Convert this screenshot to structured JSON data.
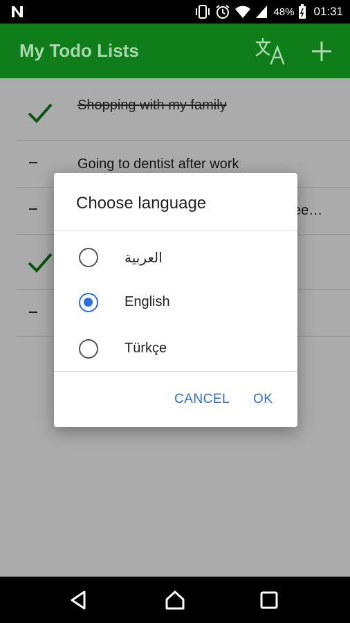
{
  "status_bar": {
    "battery_pct": "48%",
    "time": "01:31",
    "icons": [
      "n-notification-icon",
      "vibrate-icon",
      "alarm-icon",
      "wifi-icon",
      "signal-icon",
      "battery-icon"
    ]
  },
  "app_bar": {
    "title": "My Todo Lists",
    "translate_icon": "translate-icon",
    "add_icon": "add-icon",
    "color": "#0f7d1a"
  },
  "todos": [
    {
      "text": "Shopping with my family",
      "done": true
    },
    {
      "text": "Going to dentist after work",
      "done": false
    },
    {
      "text": "ee…",
      "done": false
    },
    {
      "text": "",
      "done": true
    },
    {
      "text": "",
      "done": false
    }
  ],
  "dialog": {
    "title": "Choose language",
    "options": [
      {
        "label": "العربية",
        "selected": false
      },
      {
        "label": "English",
        "selected": true
      },
      {
        "label": "Türkçe",
        "selected": false
      }
    ],
    "cancel_label": "CANCEL",
    "ok_label": "OK",
    "accent": "#2a6fdb"
  },
  "nav_bar": {
    "icons": [
      "back-icon",
      "home-icon",
      "recents-icon"
    ]
  }
}
